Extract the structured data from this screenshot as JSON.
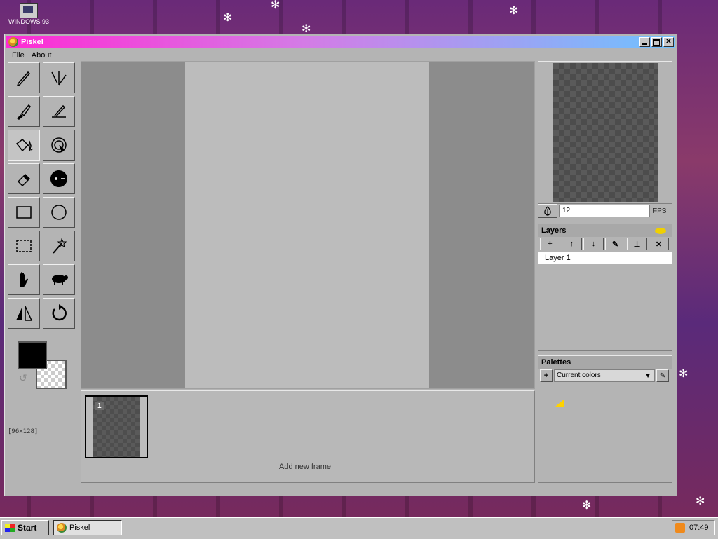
{
  "desktop": {
    "icon_label": "WINDOWS 93"
  },
  "window": {
    "title": "Piskel",
    "buttons": [
      "minimize",
      "maximize",
      "close"
    ]
  },
  "menu": {
    "items": [
      "File",
      "About"
    ]
  },
  "tools": [
    {
      "name": "pen-tool",
      "icon": "pencil-icon"
    },
    {
      "name": "vertical-mirror-pen-tool",
      "icon": "mirror-pen-icon"
    },
    {
      "name": "paint-bucket-tool-alt",
      "icon": "brush-icon"
    },
    {
      "name": "stroke-tool",
      "icon": "line-pen-icon"
    },
    {
      "name": "paint-bucket-tool",
      "icon": "bucket-icon",
      "active": true
    },
    {
      "name": "paint-all-same-color-tool",
      "icon": "magic-bucket-icon"
    },
    {
      "name": "eraser-tool",
      "icon": "eraser-icon"
    },
    {
      "name": "lighten-darken-tool",
      "icon": "lighten-darken-icon"
    },
    {
      "name": "rectangle-tool",
      "icon": "rectangle-icon"
    },
    {
      "name": "circle-tool",
      "icon": "circle-icon"
    },
    {
      "name": "rectangle-selection-tool",
      "icon": "selection-icon"
    },
    {
      "name": "magic-wand-tool",
      "icon": "wand-icon"
    },
    {
      "name": "move-tool",
      "icon": "hand-icon"
    },
    {
      "name": "shape-selection-tool",
      "icon": "sheep-icon"
    },
    {
      "name": "flip-tool",
      "icon": "flip-icon"
    },
    {
      "name": "rotate-tool",
      "icon": "rotate-icon"
    }
  ],
  "colors": {
    "primary": "#000000",
    "secondary": "transparent"
  },
  "canvas": {
    "size_label": "[96x128]"
  },
  "frames": {
    "items": [
      {
        "number": "1"
      }
    ],
    "add_label": "Add new frame"
  },
  "preview": {
    "fps_value": "12",
    "fps_label": "FPS"
  },
  "layers": {
    "title": "Layers",
    "tools": [
      "+",
      "↑",
      "↓",
      "✎",
      "⊥",
      "✕"
    ],
    "items": [
      {
        "label": "Layer 1"
      }
    ]
  },
  "palettes": {
    "title": "Palettes",
    "selected": "Current colors",
    "swatch_color": "#ffd200"
  },
  "taskbar": {
    "start_label": "Start",
    "app_label": "Piskel",
    "clock": "07:49"
  }
}
